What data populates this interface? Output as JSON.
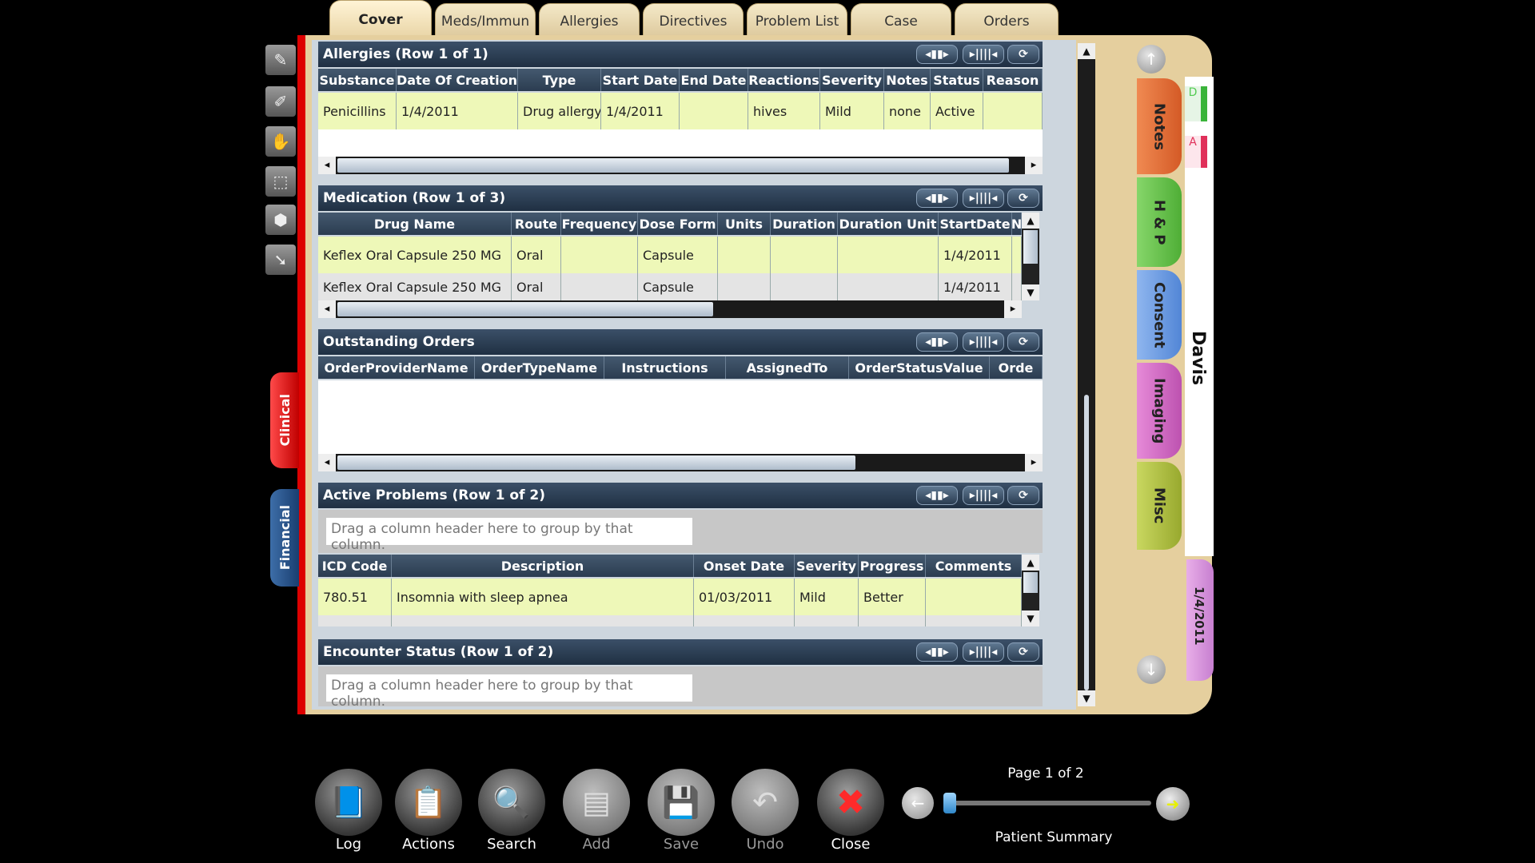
{
  "tabs": [
    "Cover",
    "Meds/Immun",
    "Allergies",
    "Directives",
    "Problem List",
    "Case",
    "Orders"
  ],
  "left_tabs": {
    "clinical": "Clinical",
    "financial": "Financial"
  },
  "right_tabs": [
    "Notes",
    "H & P",
    "Consent",
    "Imaging",
    "Misc"
  ],
  "patient": {
    "name": "Davis",
    "date": "1/4/2011"
  },
  "right_mini_tabs": [
    "D",
    "A"
  ],
  "allergies": {
    "title": "Allergies (Row 1 of 1)",
    "columns": [
      "Substance",
      "Date Of Creation",
      "Type",
      "Start Date",
      "End Date",
      "Reactions",
      "Severity",
      "Notes",
      "Status",
      "Reason"
    ],
    "rows": [
      [
        "Penicillins",
        "1/4/2011",
        "Drug allergy",
        "1/4/2011",
        "",
        "hives",
        "Mild",
        "none",
        "Active",
        ""
      ]
    ]
  },
  "medication": {
    "title": "Medication (Row 1 of 3)",
    "columns": [
      "Drug Name",
      "Route",
      "Frequency",
      "Dose Form",
      "Units",
      "Duration",
      "Duration Unit",
      "StartDate",
      "N"
    ],
    "rows": [
      [
        "Keflex Oral Capsule 250 MG",
        "Oral",
        "",
        "Capsule",
        "",
        "",
        "",
        "1/4/2011"
      ],
      [
        "Keflex Oral Capsule 250 MG",
        "Oral",
        "",
        "Capsule",
        "",
        "",
        "",
        "1/4/2011"
      ]
    ]
  },
  "orders": {
    "title": "Outstanding Orders",
    "columns": [
      "OrderProviderName",
      "OrderTypeName",
      "Instructions",
      "AssignedTo",
      "OrderStatusValue",
      "Orde"
    ]
  },
  "problems": {
    "title": "Active Problems (Row 1 of 2)",
    "drag_hint": "Drag a column header here to group by that column.",
    "columns": [
      "ICD Code",
      "Description",
      "Onset Date",
      "Severity",
      "Progress",
      "Comments"
    ],
    "rows": [
      [
        "780.51",
        "Insomnia with sleep apnea",
        "01/03/2011",
        "Mild",
        "Better",
        ""
      ]
    ]
  },
  "encounter": {
    "title": "Encounter Status (Row 1 of 2)",
    "drag_hint": "Drag a column header here to group by that column."
  },
  "toolbar": {
    "log": "Log",
    "actions": "Actions",
    "search": "Search",
    "add": "Add",
    "save": "Save",
    "undo": "Undo",
    "close": "Close"
  },
  "pager": {
    "page": "Page 1 of 2",
    "label": "Patient Summary",
    "progress": 0
  },
  "colors": {
    "accent_red": "#dd0000",
    "binder": "#e5cf9e",
    "header_navy": "#1f2f42",
    "row_highlight": "#eef8b8"
  }
}
